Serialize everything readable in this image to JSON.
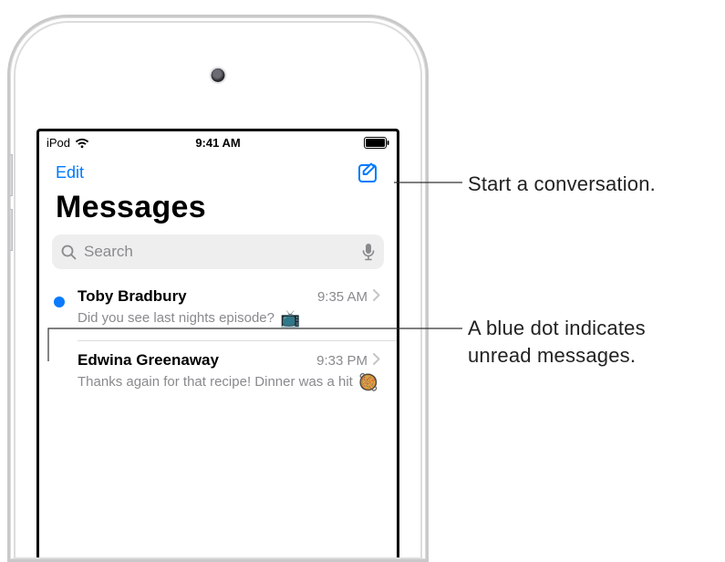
{
  "statusbar": {
    "device": "iPod",
    "time": "9:41 AM"
  },
  "nav": {
    "edit_label": "Edit"
  },
  "title": "Messages",
  "search": {
    "placeholder": "Search"
  },
  "conversations": [
    {
      "name": "Toby Bradbury",
      "time": "9:35 AM",
      "preview": "Did you see last nights episode?",
      "emoji": "📺",
      "unread": true
    },
    {
      "name": "Edwina Greenaway",
      "time": "9:33 PM",
      "preview": "Thanks again for that recipe! Dinner was a hit",
      "emoji": "🥘",
      "unread": false
    }
  ],
  "callouts": {
    "compose": "Start a conversation.",
    "unread": "A blue dot indicates unread messages."
  }
}
